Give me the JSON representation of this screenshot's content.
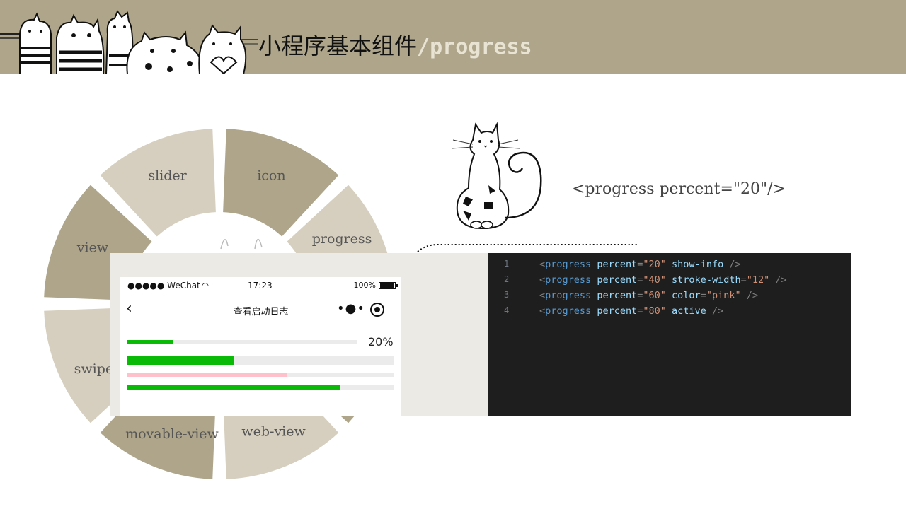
{
  "header": {
    "title_main": "小程序基本组件",
    "title_sub": "/progress"
  },
  "ring": {
    "segments": [
      {
        "label": "slider"
      },
      {
        "label": "icon"
      },
      {
        "label": "view"
      },
      {
        "label": "progress"
      },
      {
        "label": "swiper"
      },
      {
        "label": "movable-view"
      },
      {
        "label": "web-view"
      }
    ]
  },
  "snippet": "<progress percent=\"20\"/>",
  "phone": {
    "status": {
      "carrier": "●●●●● WeChat",
      "time": "17:23",
      "battery": "100%"
    },
    "nav": {
      "back": "‹",
      "title": "查看启动日志",
      "more": "•●•"
    },
    "percent_label": "20%",
    "bars": [
      {
        "percent": 20,
        "color": "#09bb07"
      },
      {
        "percent": 40,
        "color": "#09bb07"
      },
      {
        "percent": 60,
        "color": "#ffc0cb"
      },
      {
        "percent": 80,
        "color": "#09bb07"
      }
    ]
  },
  "editor": {
    "lines": [
      {
        "n": "1",
        "tag": "progress",
        "value": "20",
        "extra_attr": "show-info",
        "extra_value": ""
      },
      {
        "n": "2",
        "tag": "progress",
        "value": "40",
        "extra_attr": "stroke-width",
        "extra_value": "\"12\""
      },
      {
        "n": "3",
        "tag": "progress",
        "value": "60",
        "extra_attr": "color",
        "extra_value": "\"pink\""
      },
      {
        "n": "4",
        "tag": "progress",
        "value": "80",
        "extra_attr": "active",
        "extra_value": ""
      }
    ]
  }
}
